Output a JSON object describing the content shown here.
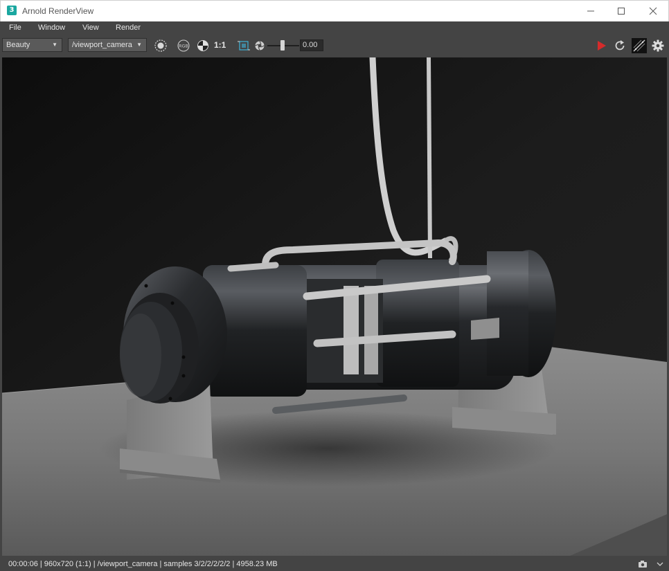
{
  "window": {
    "title": "Arnold RenderView",
    "app_icon_glyph": "3"
  },
  "menu": {
    "items": [
      "File",
      "Window",
      "View",
      "Render"
    ]
  },
  "toolbar": {
    "aov_select": "Beauty",
    "camera_select": "/viewport_camera",
    "ratio_label": "1:1",
    "exposure_value": "0.00",
    "render_button_color": "#d52b2b",
    "icons": [
      "display-circle-icon",
      "rgb-channel-icon",
      "checker-icon",
      "region-crop-icon",
      "aperture-icon",
      "render-play-icon",
      "refresh-icon",
      "debug-shading-icon",
      "settings-gear-icon"
    ]
  },
  "status": {
    "text": "00:00:06 | 960x720 (1:1) | /viewport_camera  | samples 3/2/2/2/2/2 | 4958.23 MB"
  },
  "colors": {
    "panel": "#444444",
    "viewport_bg": "#151515",
    "accent_teal": "#1aa7a0"
  }
}
